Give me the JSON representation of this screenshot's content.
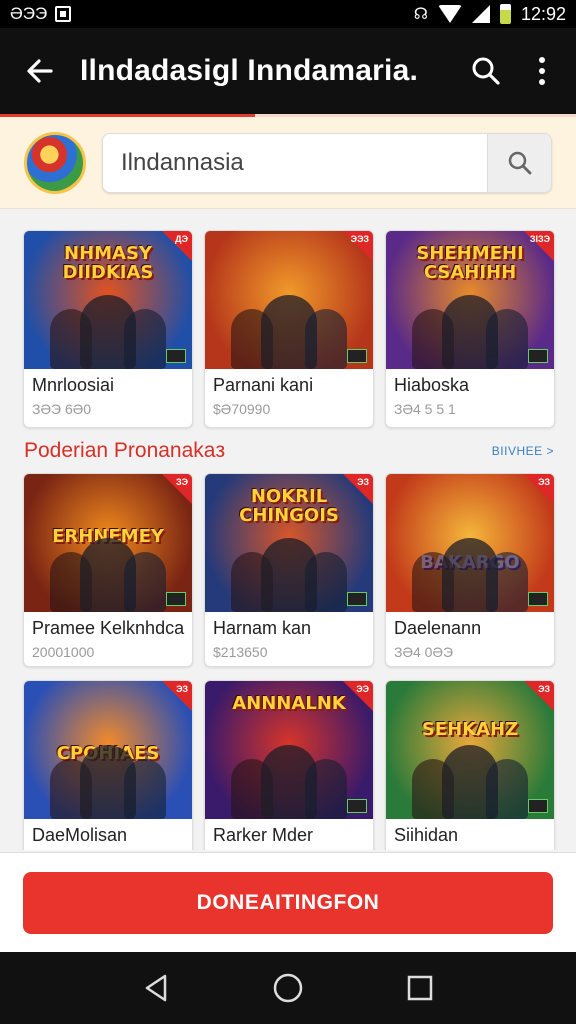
{
  "status_bar": {
    "left_text": "ƏЭЭ",
    "time": "12:92",
    "icons": [
      "notification-icon",
      "vibrate-icon",
      "wifi-icon",
      "signal-icon",
      "battery-icon"
    ]
  },
  "app_bar": {
    "title": "Ilndadasigl Inndamaria.",
    "icons": [
      "back-arrow-icon",
      "search-icon",
      "more-vertical-icon"
    ]
  },
  "search": {
    "value": "Ilndannasia",
    "icon": "search-icon"
  },
  "section": {
    "title": "Poderian Pronanakaз",
    "more_label": "BIIVHEE >"
  },
  "row1": [
    {
      "title": "Mnrloosiai",
      "sub": "ЗӘЭ 6Ә0",
      "logo": "NHMASY DIIDKIAS",
      "ribbon": "ДЭ",
      "colors": [
        "#1f4fa8",
        "#e2521f"
      ]
    },
    {
      "title": "Parnani kani",
      "sub": "$Ә70990",
      "logo": "",
      "ribbon": "ЭЭЗ",
      "colors": [
        "#b5361b",
        "#f19a2a"
      ]
    },
    {
      "title": "Hiaboska",
      "sub": "ЗӘ4 5 5 1",
      "logo": "SHEHMEHI CSAHIHH",
      "ribbon": "ЗІЗЭ",
      "colors": [
        "#5a2a88",
        "#e88a2a"
      ]
    }
  ],
  "row2": [
    {
      "title": "Pramee Kelknhdca",
      "sub": "20001000",
      "logo": "ERHNEMEY",
      "ribbon": "ЗЭ",
      "colors": [
        "#7a2414",
        "#f08a1e"
      ]
    },
    {
      "title": "Harnam kan",
      "sub": "$213650",
      "logo": "NOKRIL CHINGOIS",
      "ribbon": "ЭЗ",
      "colors": [
        "#243a7a",
        "#d6562a"
      ]
    },
    {
      "title": "Daelenann",
      "sub": "ЗӘ4 0ӘЭ",
      "logo": "BAKARGO",
      "ribbon": "ЭЗ",
      "colors": [
        "#c23a1a",
        "#f5b63a"
      ]
    }
  ],
  "row3": [
    {
      "title": "DaeMolisan",
      "sub": "",
      "logo": "CPOHIAES",
      "ribbon": "ЭЗ",
      "colors": [
        "#2a4fb5",
        "#f28a2a"
      ]
    },
    {
      "title": "Rarker Mder",
      "sub": "",
      "logo": "ANNNALNK",
      "ribbon": "ЭЭ",
      "colors": [
        "#3a1a6a",
        "#d6342a"
      ]
    },
    {
      "title": "Siihidan",
      "sub": "",
      "logo": "SEHKAHZ",
      "ribbon": "ЭЗ",
      "colors": [
        "#2a7a3a",
        "#e8a83a"
      ]
    }
  ],
  "cta": {
    "label": "DONEAITINGFON"
  },
  "nav": {
    "icons": [
      "back-triangle-icon",
      "home-circle-icon",
      "recents-square-icon"
    ]
  },
  "colors": {
    "accent": "#e8342c",
    "app_bar": "#101010",
    "search_row": "#fdf3df"
  }
}
